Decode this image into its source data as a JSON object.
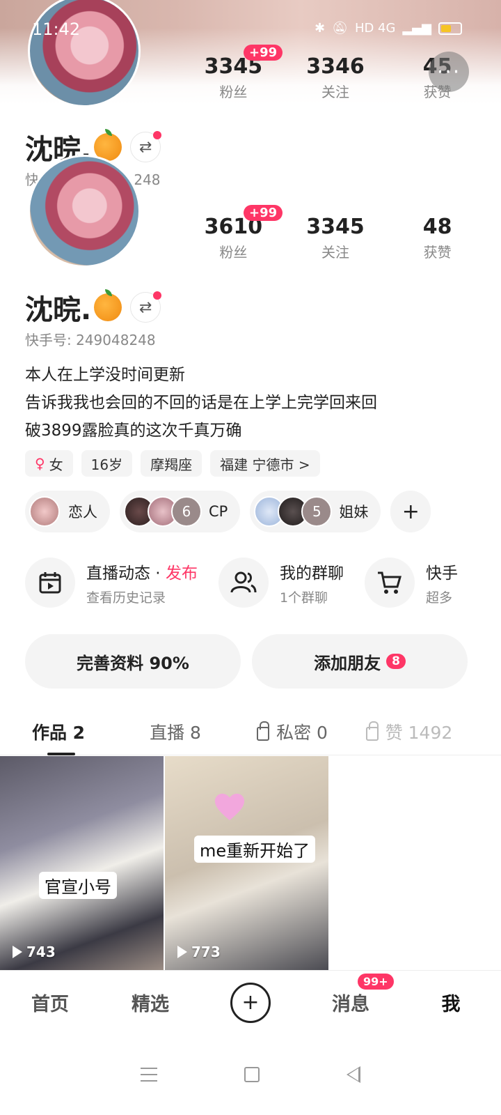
{
  "status_bar": {
    "time": "11:42",
    "indicators": "HD 4G",
    "icons": [
      "bluetooth-icon",
      "mute-icon",
      "signal-icon",
      "battery-icon"
    ]
  },
  "ghost_header": {
    "stats": [
      {
        "value": "3345",
        "label": "粉丝",
        "badge": "+99"
      },
      {
        "value": "3346",
        "label": "关注"
      },
      {
        "value": "45",
        "label": "获赞"
      }
    ],
    "name": "沈晥.",
    "id_fragment": "快",
    "id_tail": "248"
  },
  "more_button": "···",
  "profile": {
    "name": "沈晥.",
    "stats": [
      {
        "value": "3610",
        "label": "粉丝",
        "badge": "+99"
      },
      {
        "value": "3345",
        "label": "关注"
      },
      {
        "value": "48",
        "label": "获赞"
      }
    ],
    "user_id": "快手号: 249048248",
    "bio": [
      "本人在上学没时间更新",
      "告诉我我也会回的不回的话是在上学上完学回来回",
      "破3899露脸真的这次千真万确"
    ],
    "tags": {
      "gender": "女",
      "age": "16岁",
      "zodiac": "摩羯座",
      "location": "福建 宁德市 >"
    },
    "relations": [
      {
        "label": "恋人"
      },
      {
        "count": "6",
        "label": "CP"
      },
      {
        "count": "5",
        "label": "姐妹"
      }
    ],
    "relation_add": "+"
  },
  "features": [
    {
      "title": "直播动态 · ",
      "highlight": "发布",
      "sub": "查看历史记录",
      "icon": "calendar-play-icon"
    },
    {
      "title": "我的群聊",
      "sub": "1个群聊",
      "icon": "group-icon"
    },
    {
      "title": "快手",
      "sub": "超多",
      "icon": "cart-icon"
    }
  ],
  "cta": {
    "complete_profile": "完善资料 90%",
    "add_friends": "添加朋友",
    "add_friends_badge": "8"
  },
  "tabs": [
    {
      "label": "作品 2"
    },
    {
      "label": "直播 8"
    },
    {
      "label": "私密 0"
    },
    {
      "label": "赞 1492"
    }
  ],
  "videos": [
    {
      "caption": "官宣小号",
      "views": "743"
    },
    {
      "caption": "me重新开始了",
      "views": "773"
    }
  ],
  "bottom_nav": {
    "home": "首页",
    "featured": "精选",
    "plus": "+",
    "messages": "消息",
    "messages_badge": "99+",
    "me": "我"
  }
}
